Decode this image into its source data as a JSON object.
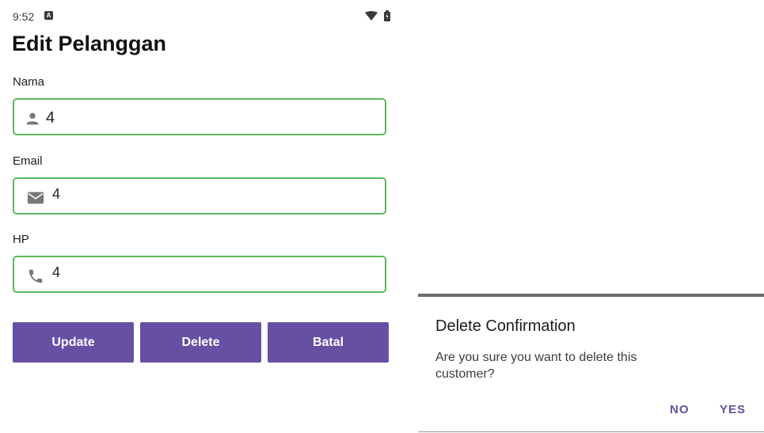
{
  "status": {
    "time": "9:52",
    "notif_icon": "a-icon",
    "wifi_icon": "wifi-icon",
    "battery_icon": "battery-icon"
  },
  "screen": {
    "title": "Edit Pelanggan"
  },
  "fields": [
    {
      "label": "Nama",
      "value": "4",
      "icon": "person-icon"
    },
    {
      "label": "Email",
      "value": "4",
      "icon": "email-icon"
    },
    {
      "label": "HP",
      "value": "4",
      "icon": "phone-icon"
    }
  ],
  "buttons": {
    "update": "Update",
    "delete": "Delete",
    "cancel": "Batal"
  },
  "dialog": {
    "title": "Delete Confirmation",
    "message": "Are you sure you want to delete this customer?",
    "no": "NO",
    "yes": "YES"
  },
  "colors": {
    "accent": "#6750a4",
    "field_border": "#5cb85c"
  }
}
